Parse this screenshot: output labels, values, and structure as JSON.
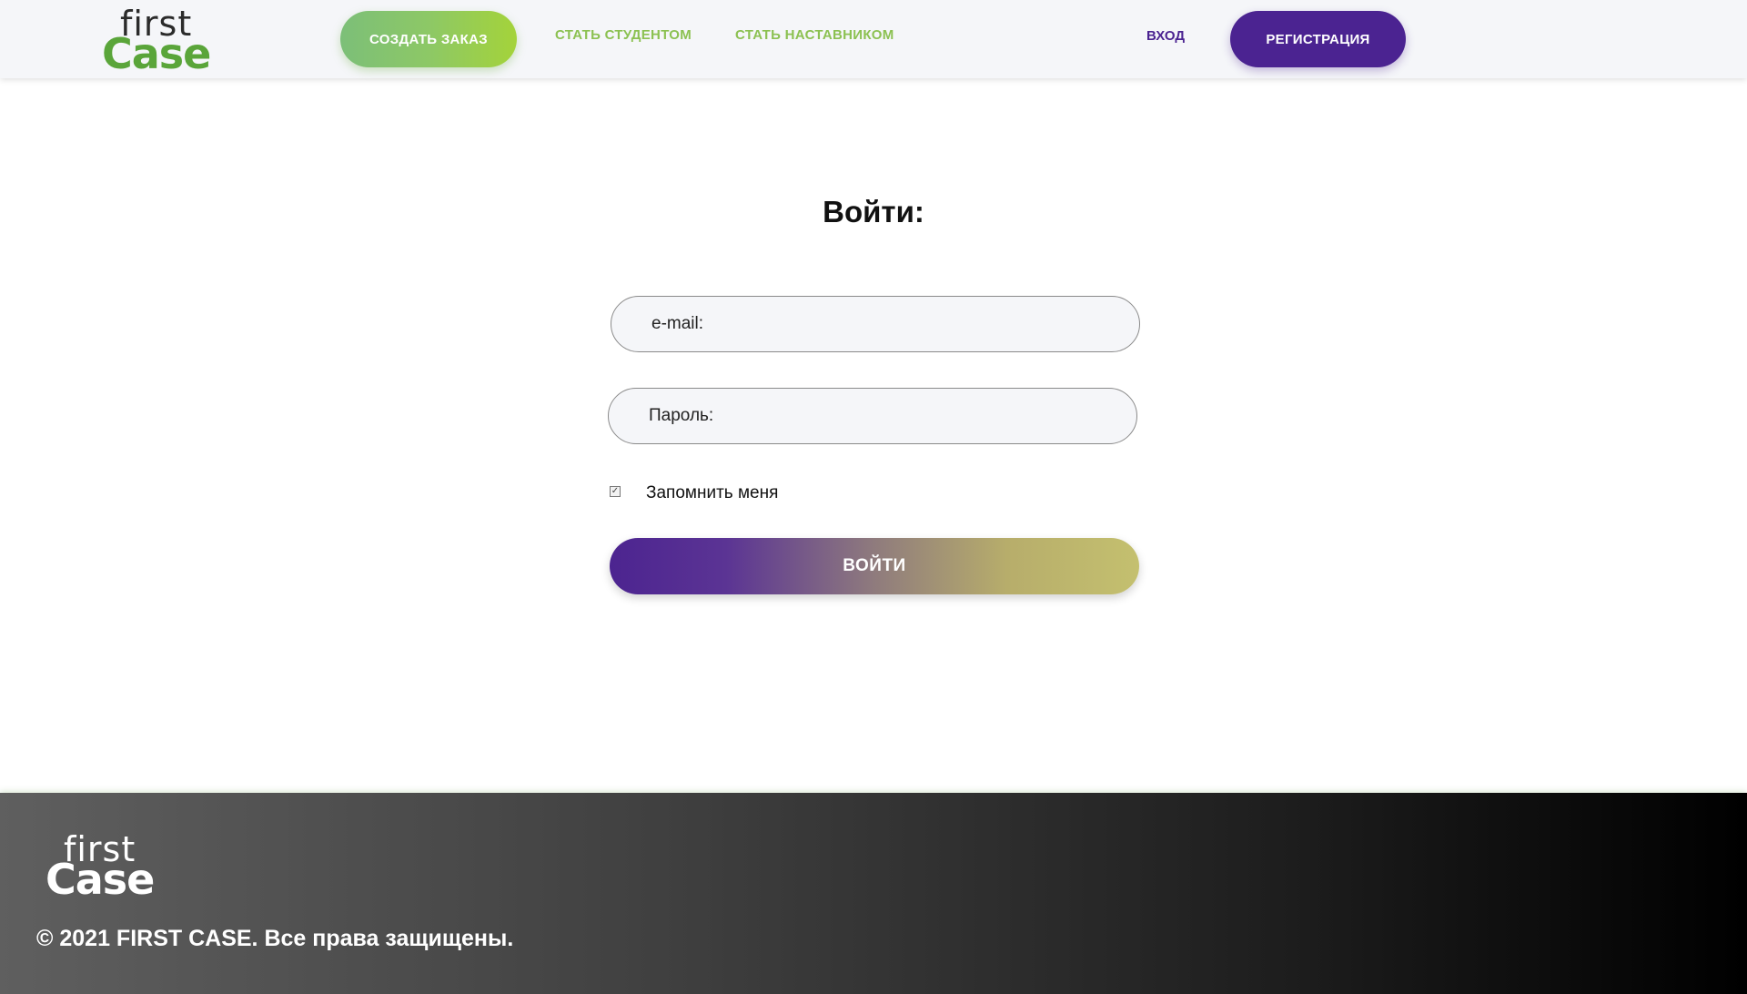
{
  "header": {
    "logo": {
      "first": "first",
      "case": "Case"
    },
    "create_order": "СОЗДАТЬ ЗАКАЗ",
    "become_student": "СТАТЬ СТУДЕНТОМ",
    "become_mentor": "СТАТЬ НАСТАВНИКОМ",
    "login": "ВХОД",
    "register": "РЕГИСТРАЦИЯ"
  },
  "form": {
    "title": "Войти:",
    "email_placeholder": "e-mail:",
    "password_placeholder": "Пароль:",
    "remember_label": "Запомнить меня",
    "remember_checked": true,
    "submit": "ВОЙТИ"
  },
  "footer": {
    "logo": {
      "first": "first",
      "case": "Case"
    },
    "copyright": "© 2021 FIRST CASE. Все права защищены."
  },
  "colors": {
    "brand_green": "#8cc152",
    "brand_purple": "#4b2391",
    "logo_green": "#5aa53a"
  }
}
